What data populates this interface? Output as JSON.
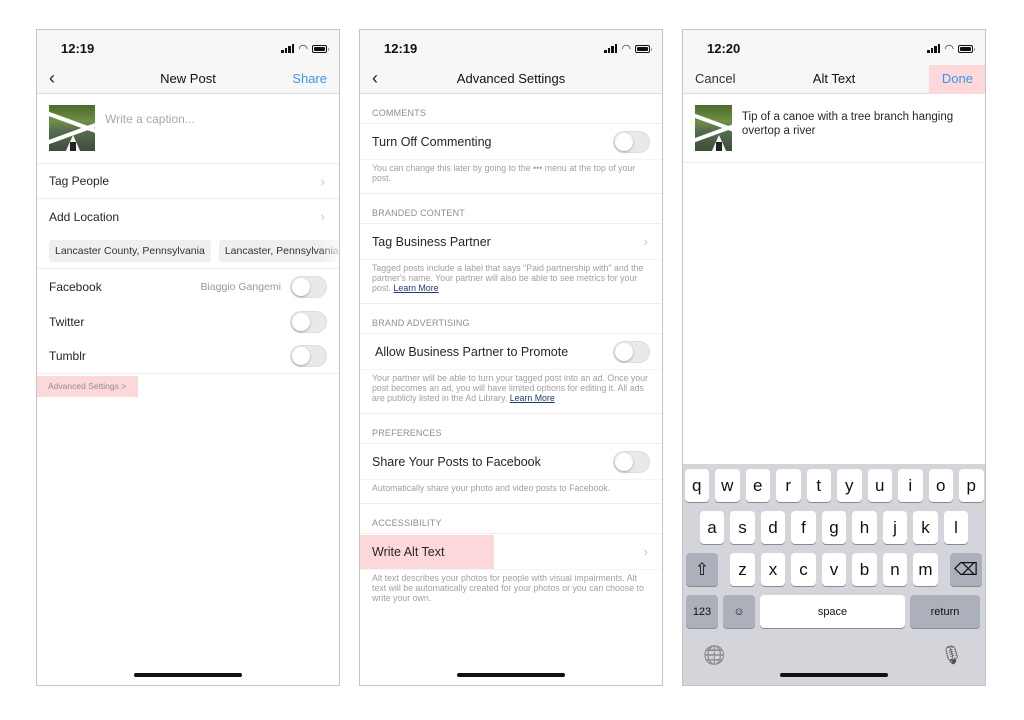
{
  "colors": {
    "accent": "#3897f0",
    "highlight": "#fdd8db",
    "link": "#1f3b6e"
  },
  "panels": [
    {
      "status_time": "12:19",
      "nav": {
        "back_icon": "chevron-left-icon",
        "title": "New Post",
        "right": "Share"
      },
      "caption_placeholder": "Write a caption...",
      "rows": {
        "tag_people": "Tag People",
        "add_location": "Add Location"
      },
      "location_chips": [
        "Lancaster County, Pennsylvania",
        "Lancaster, Pennsylvania"
      ],
      "share_to": [
        {
          "label": "Facebook",
          "account": "Biaggio Gangemi",
          "on": false
        },
        {
          "label": "Twitter",
          "on": false
        },
        {
          "label": "Tumblr",
          "on": false
        }
      ],
      "advanced_link": "Advanced Settings >"
    },
    {
      "status_time": "12:19",
      "nav": {
        "back_icon": "chevron-left-icon",
        "title": "Advanced Settings"
      },
      "sections": [
        {
          "header": "COMMENTS",
          "row": "Turn Off Commenting",
          "control": "toggle",
          "on": false,
          "desc": "You can change this later by going to the ••• menu at the top of your post."
        },
        {
          "header": "BRANDED CONTENT",
          "row": "Tag Business Partner",
          "control": "chevron",
          "desc": "Tagged posts include a label that says \"Paid partnership with\" and the partner's name. Your partner will also be able to see metrics for your post.",
          "link": "Learn More"
        },
        {
          "header": "BRAND ADVERTISING",
          "row": "Allow Business Partner to Promote",
          "control": "toggle",
          "on": false,
          "desc": "Your partner will be able to turn your tagged post into an ad. Once your post becomes an ad, you will have limited options for editing it. All ads are publicly listed in the Ad Library.",
          "link": "Learn More"
        },
        {
          "header": "PREFERENCES",
          "row": "Share Your Posts to Facebook",
          "control": "toggle",
          "on": false,
          "desc": "Automatically share your photo and video posts to Facebook."
        },
        {
          "header": "ACCESSIBILITY",
          "row": "Write Alt Text",
          "control": "chevron",
          "desc": "Alt text describes your photos for people with visual impairments. Alt text will be automatically created for your photos or you can choose to write your own."
        }
      ]
    },
    {
      "status_time": "12:20",
      "nav": {
        "left": "Cancel",
        "title": "Alt Text",
        "right": "Done"
      },
      "alt_text_value": "Tip of a canoe with a tree branch hanging overtop a river",
      "keyboard": {
        "row1": [
          "q",
          "w",
          "e",
          "r",
          "t",
          "y",
          "u",
          "i",
          "o",
          "p"
        ],
        "row2": [
          "a",
          "s",
          "d",
          "f",
          "g",
          "h",
          "j",
          "k",
          "l"
        ],
        "row3": [
          "z",
          "x",
          "c",
          "v",
          "b",
          "n",
          "m"
        ],
        "shift": "⇧",
        "backspace": "⌫",
        "numbers": "123",
        "emoji": "☺",
        "space": "space",
        "return": "return",
        "globe": "🌐",
        "mic": "🎙"
      }
    }
  ]
}
